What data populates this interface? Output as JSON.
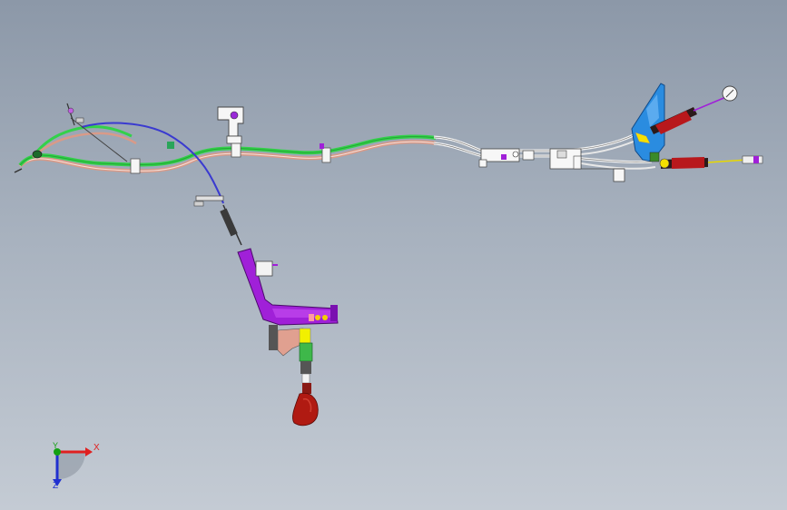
{
  "viewport": {
    "background_top": "#8c98a8",
    "background_bottom": "#c4cbd4"
  },
  "model": {
    "description_colors": {
      "cable_green": "#33d14a",
      "cable_pink": "#d99a88",
      "cable_blue": "#3a3ad0",
      "bracket_purple": "#a020d8",
      "knob_red": "#b01a12",
      "mount_blue": "#2a8ce0",
      "boot_red": "#b8181c",
      "metal_white": "#f4f4f4"
    }
  },
  "triad": {
    "x_label": "X",
    "y_label": "Y",
    "z_label": "Z",
    "x_color": "#e02020",
    "y_color": "#12a012",
    "z_color": "#2030d0"
  }
}
